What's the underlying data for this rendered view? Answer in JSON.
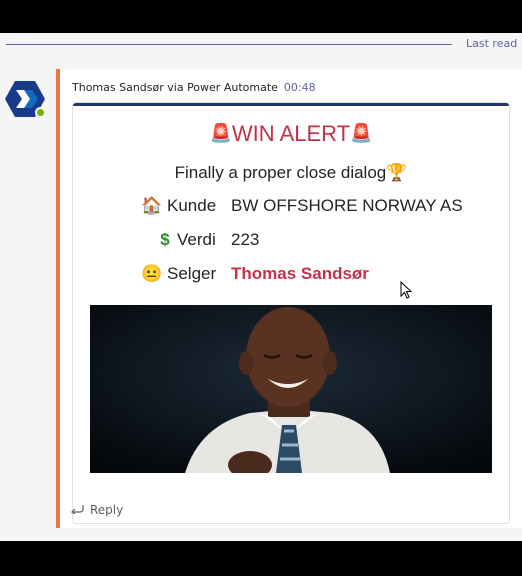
{
  "divider": {
    "last_read": "Last read"
  },
  "message": {
    "sender": "Thomas Sandsør via Power Automate",
    "time": "00:48"
  },
  "card": {
    "title": "WIN ALERT",
    "subtitle": "Finally a proper close dialog",
    "rows": [
      {
        "icon": "house-icon",
        "label": "Kunde",
        "value": "BW OFFSHORE NORWAY AS"
      },
      {
        "icon": "dollar-icon",
        "label": "Verdi",
        "value": "223"
      },
      {
        "icon": "face-icon",
        "label": "Selger",
        "value": "Thomas Sandsør"
      }
    ]
  },
  "actions": {
    "reply": "Reply"
  },
  "colors": {
    "accent": "#e97548",
    "alert_red": "#c4314b",
    "teams_purple": "#6264a7",
    "card_top": "#24356b"
  }
}
